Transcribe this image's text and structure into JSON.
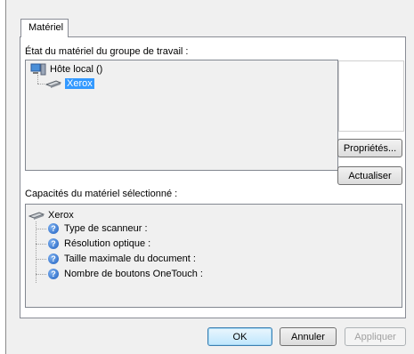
{
  "tab": {
    "label": "Matériel"
  },
  "workgroup": {
    "label": "État du matériel du groupe de travail :",
    "host": "Hôte local ()",
    "device": "Xerox"
  },
  "buttons": {
    "properties": "Propriétés...",
    "refresh": "Actualiser",
    "ok": "OK",
    "cancel": "Annuler",
    "apply": "Appliquer"
  },
  "capabilities": {
    "label": "Capacités du matériel sélectionné :",
    "device": "Xerox",
    "items": [
      "Type de scanneur :",
      "Résolution optique :",
      "Taille maximale du document :",
      "Nombre de boutons OneTouch :"
    ]
  },
  "colors": {
    "selection": "#3399ff",
    "help_icon": "#1e5fc0"
  },
  "icons": {
    "host": "computer-icon",
    "device": "scanner-icon",
    "capability": "help-icon"
  }
}
